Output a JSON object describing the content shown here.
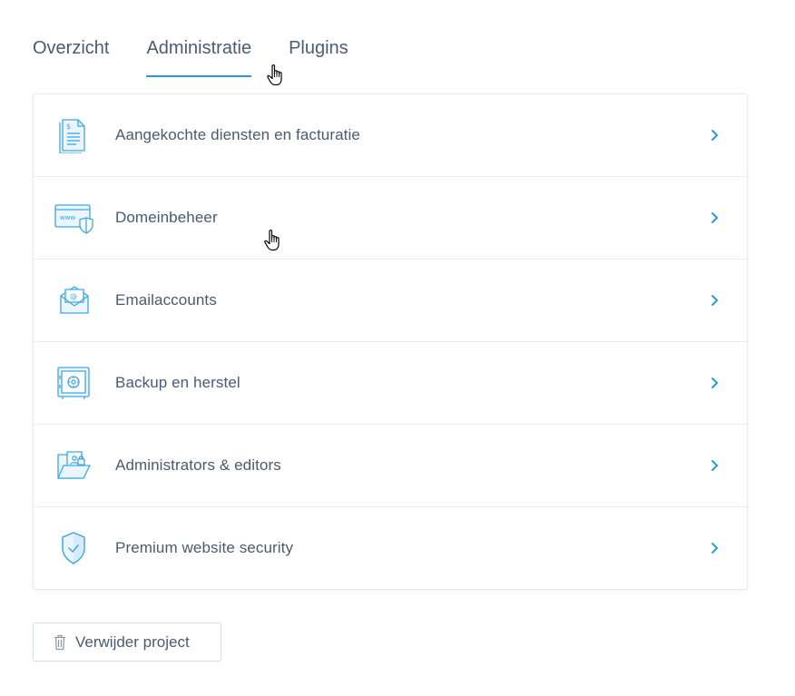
{
  "tabs": [
    {
      "label": "Overzicht",
      "active": false
    },
    {
      "label": "Administratie",
      "active": true
    },
    {
      "label": "Plugins",
      "active": false
    }
  ],
  "items": [
    {
      "label": "Aangekochte diensten en facturatie",
      "icon": "invoice-document-icon"
    },
    {
      "label": "Domeinbeheer",
      "icon": "www-browser-shield-icon"
    },
    {
      "label": "Emailaccounts",
      "icon": "envelope-at-icon"
    },
    {
      "label": "Backup en herstel",
      "icon": "safe-vault-icon"
    },
    {
      "label": "Administrators & editors",
      "icon": "folder-user-icon"
    },
    {
      "label": "Premium website security",
      "icon": "shield-check-icon"
    }
  ],
  "delete_button": {
    "label": "Verwijder project",
    "icon": "trash-icon"
  },
  "colors": {
    "accent": "#2c98d8",
    "text": "#4a5a70",
    "icon": "#3ea6e6"
  }
}
